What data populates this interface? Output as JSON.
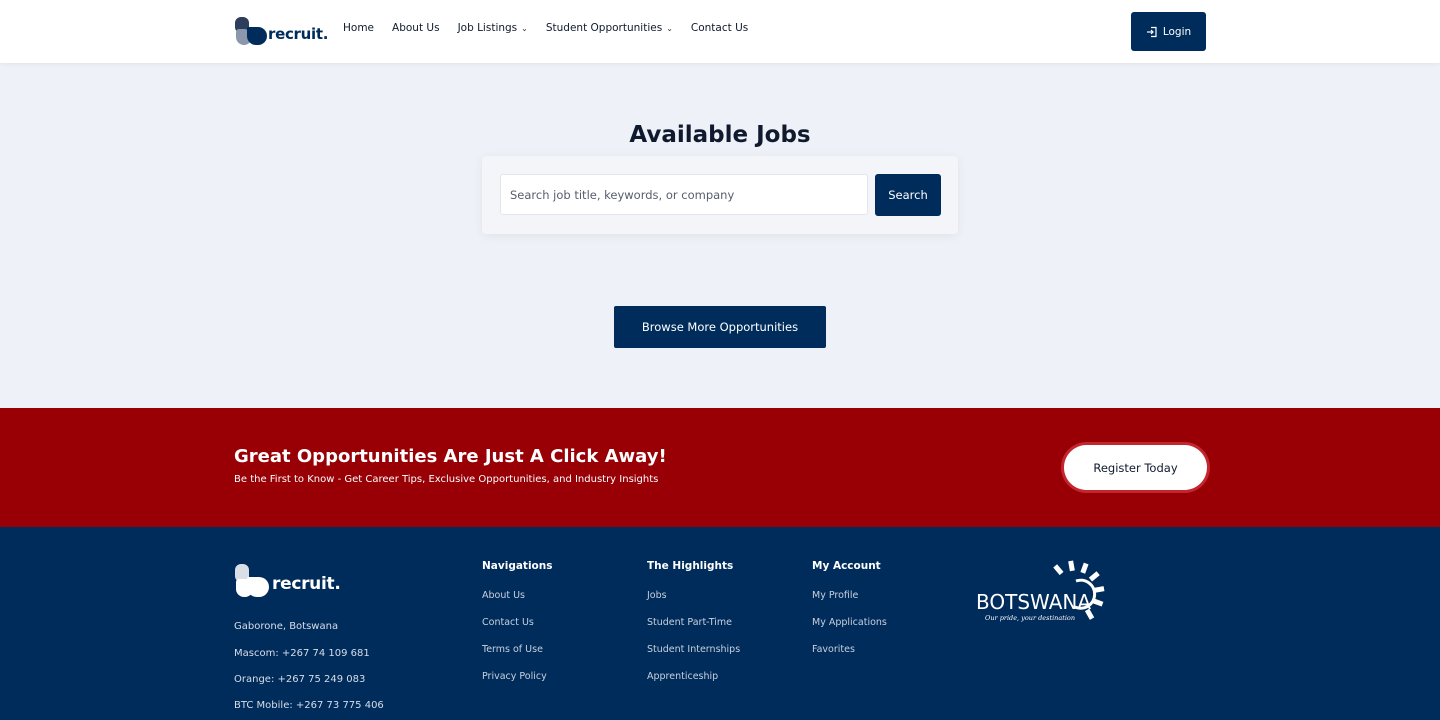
{
  "header": {
    "brand": "recruit.",
    "nav": [
      {
        "label": "Home",
        "dropdown": false
      },
      {
        "label": "About Us",
        "dropdown": false
      },
      {
        "label": "Job Listings",
        "dropdown": true
      },
      {
        "label": "Student Opportunities",
        "dropdown": true
      },
      {
        "label": "Contact Us",
        "dropdown": false
      }
    ],
    "login_label": "Login"
  },
  "main": {
    "title": "Available Jobs",
    "search_placeholder": "Search job title, keywords, or company",
    "search_button": "Search",
    "browse_button": "Browse More Opportunities"
  },
  "cta": {
    "title": "Great Opportunities Are Just A Click Away!",
    "subtitle": "Be the First to Know - Get Career Tips, Exclusive Opportunities, and Industry Insights",
    "register_button": "Register Today"
  },
  "footer": {
    "brand": "recruit.",
    "contact": [
      "Gaborone, Botswana",
      "Mascom: +267 74 109 681",
      "Orange: +267 75 249 083",
      "BTC Mobile: +267 73 775 406"
    ],
    "columns": [
      {
        "heading": "Navigations",
        "links": [
          "About Us",
          "Contact Us",
          "Terms of Use",
          "Privacy Policy"
        ]
      },
      {
        "heading": "The Highlights",
        "links": [
          "Jobs",
          "Student Part-Time",
          "Student Internships",
          "Apprenticeship"
        ]
      },
      {
        "heading": "My Account",
        "links": [
          "My Profile",
          "My Applications",
          "Favorites"
        ]
      }
    ],
    "partner_logo": {
      "name": "BOTSWANA",
      "tagline": "Our pride, your destination"
    }
  },
  "colors": {
    "navy": "#002c5b",
    "red": "#980006",
    "background": "#eef1f7"
  }
}
